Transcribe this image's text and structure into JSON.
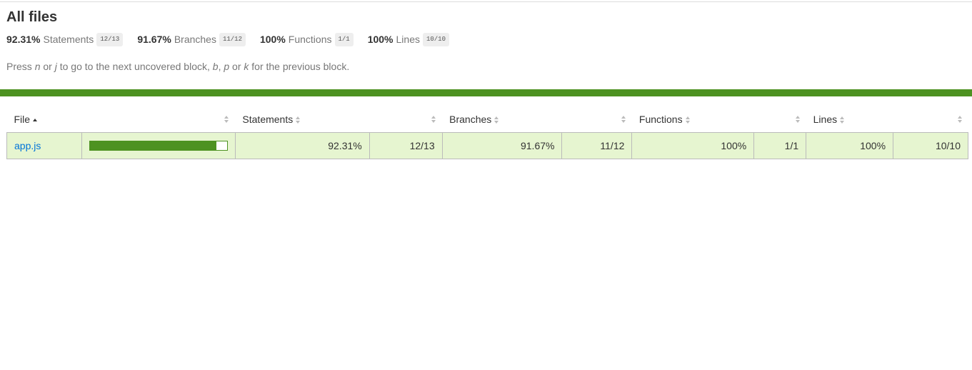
{
  "page": {
    "title": "All files",
    "summary": [
      {
        "pct": "92.31%",
        "label": "Statements",
        "fraction": "12/13"
      },
      {
        "pct": "91.67%",
        "label": "Branches",
        "fraction": "11/12"
      },
      {
        "pct": "100%",
        "label": "Functions",
        "fraction": "1/1"
      },
      {
        "pct": "100%",
        "label": "Lines",
        "fraction": "10/10"
      }
    ],
    "hint": {
      "p1": "Press ",
      "k1": "n",
      "p2": " or ",
      "k2": "j",
      "p3": " to go to the next uncovered block, ",
      "k3": "b",
      "p4": ", ",
      "k4": "p",
      "p5": " or ",
      "k5": "k",
      "p6": " for the previous block."
    }
  },
  "colors": {
    "status_high": "#4d9221",
    "row_high": "#e6f5d0",
    "link": "#0074d9"
  },
  "table": {
    "headers": {
      "file": "File",
      "statements": "Statements",
      "branches": "Branches",
      "functions": "Functions",
      "lines": "Lines"
    },
    "sort": {
      "column": "file",
      "direction": "asc"
    },
    "rows": [
      {
        "file": "app.js",
        "coverage_fraction": 0.9231,
        "statements_pct": "92.31%",
        "statements_fraction": "12/13",
        "branches_pct": "91.67%",
        "branches_fraction": "11/12",
        "functions_pct": "100%",
        "functions_fraction": "1/1",
        "lines_pct": "100%",
        "lines_fraction": "10/10"
      }
    ]
  }
}
